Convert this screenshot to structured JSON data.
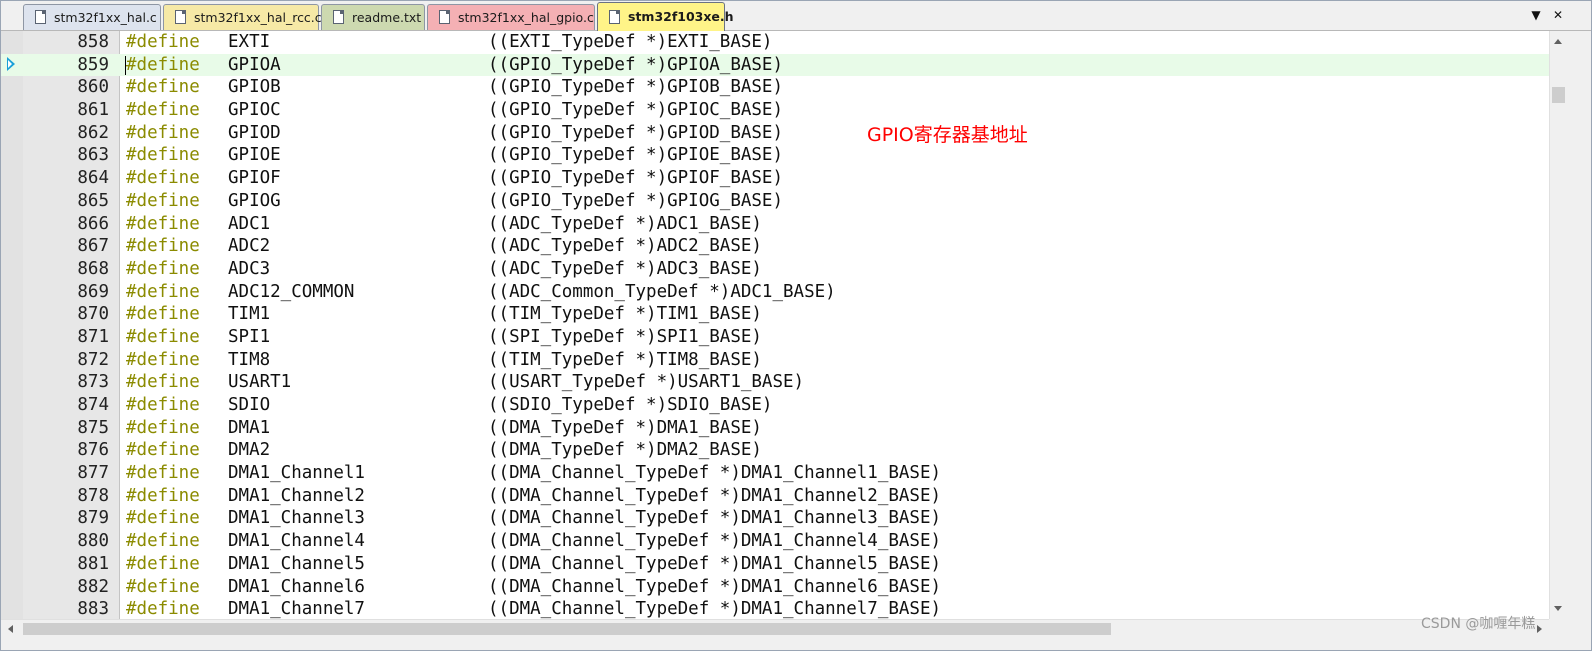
{
  "tabs": [
    {
      "label": "stm32f1xx_hal.c",
      "active": false,
      "bg": "#dde3ee"
    },
    {
      "label": "stm32f1xx_hal_rcc.c",
      "active": false,
      "bg": "#f6e9a6"
    },
    {
      "label": "readme.txt",
      "active": false,
      "bg": "#cdd9b0"
    },
    {
      "label": "stm32f1xx_hal_gpio.c",
      "active": false,
      "bg": "#f4b0b4"
    },
    {
      "label": "stm32f103xe.h",
      "active": true,
      "bg": "#fff488"
    }
  ],
  "tabbar_controls": {
    "dropdown_glyph": "▼",
    "close_glyph": "✕"
  },
  "editor": {
    "current_line": 859,
    "keyword_color": "#8b8b00",
    "current_line_bg": "#e8fbe8",
    "lines": [
      {
        "num": "858",
        "kw": "#define",
        "name": "EXTI",
        "value": "((EXTI_TypeDef *)EXTI_BASE)"
      },
      {
        "num": "859",
        "kw": "#define",
        "name": "GPIOA",
        "value": "((GPIO_TypeDef *)GPIOA_BASE)"
      },
      {
        "num": "860",
        "kw": "#define",
        "name": "GPIOB",
        "value": "((GPIO_TypeDef *)GPIOB_BASE)"
      },
      {
        "num": "861",
        "kw": "#define",
        "name": "GPIOC",
        "value": "((GPIO_TypeDef *)GPIOC_BASE)"
      },
      {
        "num": "862",
        "kw": "#define",
        "name": "GPIOD",
        "value": "((GPIO_TypeDef *)GPIOD_BASE)"
      },
      {
        "num": "863",
        "kw": "#define",
        "name": "GPIOE",
        "value": "((GPIO_TypeDef *)GPIOE_BASE)"
      },
      {
        "num": "864",
        "kw": "#define",
        "name": "GPIOF",
        "value": "((GPIO_TypeDef *)GPIOF_BASE)"
      },
      {
        "num": "865",
        "kw": "#define",
        "name": "GPIOG",
        "value": "((GPIO_TypeDef *)GPIOG_BASE)"
      },
      {
        "num": "866",
        "kw": "#define",
        "name": "ADC1",
        "value": "((ADC_TypeDef *)ADC1_BASE)"
      },
      {
        "num": "867",
        "kw": "#define",
        "name": "ADC2",
        "value": "((ADC_TypeDef *)ADC2_BASE)"
      },
      {
        "num": "868",
        "kw": "#define",
        "name": "ADC3",
        "value": "((ADC_TypeDef *)ADC3_BASE)"
      },
      {
        "num": "869",
        "kw": "#define",
        "name": "ADC12_COMMON",
        "value": "((ADC_Common_TypeDef *)ADC1_BASE)"
      },
      {
        "num": "870",
        "kw": "#define",
        "name": "TIM1",
        "value": "((TIM_TypeDef *)TIM1_BASE)"
      },
      {
        "num": "871",
        "kw": "#define",
        "name": "SPI1",
        "value": "((SPI_TypeDef *)SPI1_BASE)"
      },
      {
        "num": "872",
        "kw": "#define",
        "name": "TIM8",
        "value": "((TIM_TypeDef *)TIM8_BASE)"
      },
      {
        "num": "873",
        "kw": "#define",
        "name": "USART1",
        "value": "((USART_TypeDef *)USART1_BASE)"
      },
      {
        "num": "874",
        "kw": "#define",
        "name": "SDIO",
        "value": "((SDIO_TypeDef *)SDIO_BASE)"
      },
      {
        "num": "875",
        "kw": "#define",
        "name": "DMA1",
        "value": "((DMA_TypeDef *)DMA1_BASE)"
      },
      {
        "num": "876",
        "kw": "#define",
        "name": "DMA2",
        "value": "((DMA_TypeDef *)DMA2_BASE)"
      },
      {
        "num": "877",
        "kw": "#define",
        "name": "DMA1_Channel1",
        "value": "((DMA_Channel_TypeDef *)DMA1_Channel1_BASE)"
      },
      {
        "num": "878",
        "kw": "#define",
        "name": "DMA1_Channel2",
        "value": "((DMA_Channel_TypeDef *)DMA1_Channel2_BASE)"
      },
      {
        "num": "879",
        "kw": "#define",
        "name": "DMA1_Channel3",
        "value": "((DMA_Channel_TypeDef *)DMA1_Channel3_BASE)"
      },
      {
        "num": "880",
        "kw": "#define",
        "name": "DMA1_Channel4",
        "value": "((DMA_Channel_TypeDef *)DMA1_Channel4_BASE)"
      },
      {
        "num": "881",
        "kw": "#define",
        "name": "DMA1_Channel5",
        "value": "((DMA_Channel_TypeDef *)DMA1_Channel5_BASE)"
      },
      {
        "num": "882",
        "kw": "#define",
        "name": "DMA1_Channel6",
        "value": "((DMA_Channel_TypeDef *)DMA1_Channel6_BASE)"
      },
      {
        "num": "883",
        "kw": "#define",
        "name": "DMA1_Channel7",
        "value": "((DMA_Channel_TypeDef *)DMA1_Channel7_BASE)"
      }
    ]
  },
  "annotation": {
    "text": "GPIO寄存器基地址",
    "color": "#ff0000"
  },
  "watermark": "CSDN @咖喱年糕"
}
